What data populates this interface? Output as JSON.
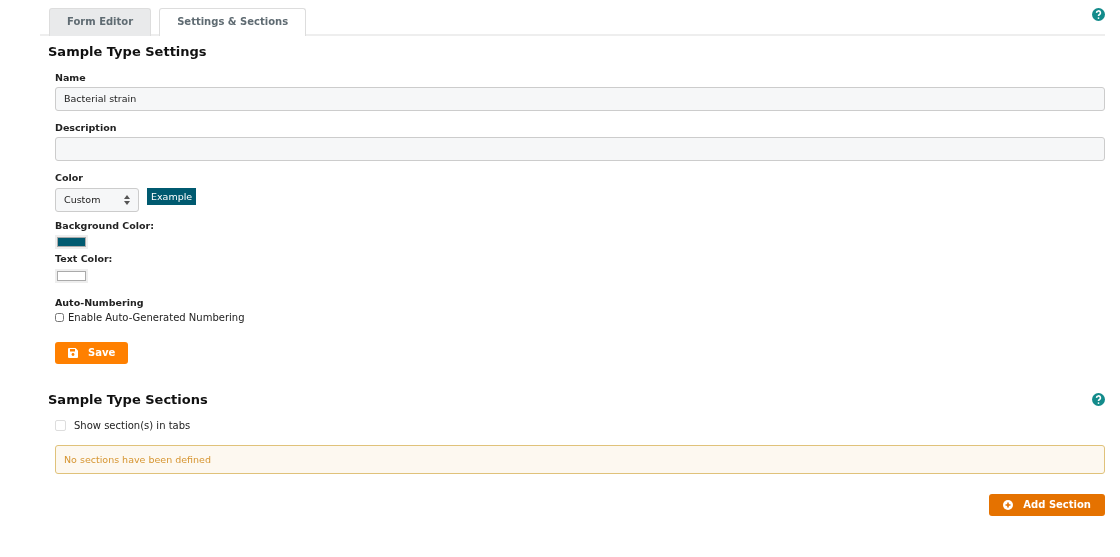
{
  "tabs": [
    {
      "label": "Form Editor",
      "selected": false
    },
    {
      "label": "Settings & Sections",
      "selected": true
    }
  ],
  "settings": {
    "title": "Sample Type Settings",
    "name": {
      "label": "Name",
      "value": "Bacterial strain"
    },
    "description": {
      "label": "Description"
    },
    "color": {
      "label": "Color",
      "value": "Custom",
      "example": "Example"
    },
    "background_color": {
      "label": "Background Color:",
      "color": "#005a70"
    },
    "text_color": {
      "label": "Text Color:",
      "color": "#ffffff"
    },
    "auto_numbering": {
      "label": "Auto-Numbering",
      "option": "Enable Auto-Generated Numbering",
      "checked": false
    },
    "save": "Save"
  },
  "sections": {
    "title": "Sample Type Sections",
    "show_in_tabs": {
      "label": "Show section(s) in tabs",
      "checked": false
    },
    "notice": "No sections have been defined",
    "add": "Add Section"
  }
}
